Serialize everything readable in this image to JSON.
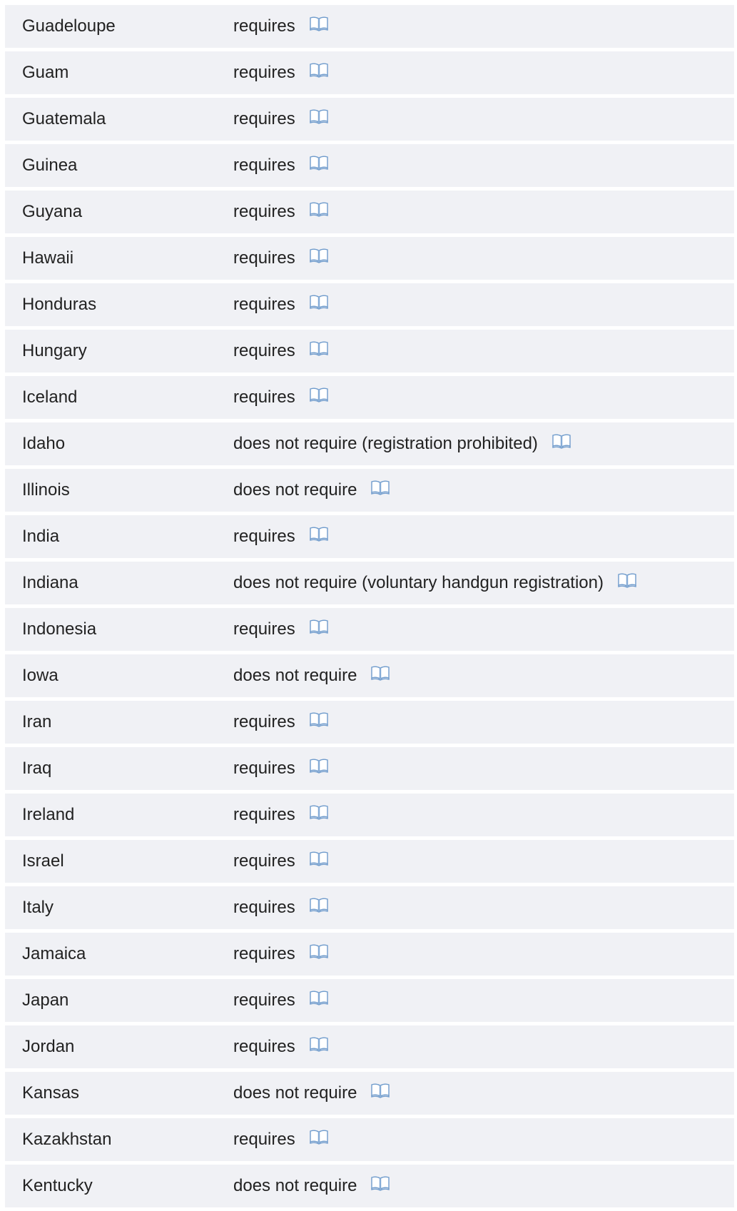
{
  "rows": [
    {
      "country": "Guadeloupe",
      "status": "requires",
      "icon": "book-icon"
    },
    {
      "country": "Guam",
      "status": "requires",
      "icon": "book-icon"
    },
    {
      "country": "Guatemala",
      "status": "requires",
      "icon": "book-icon"
    },
    {
      "country": "Guinea",
      "status": "requires",
      "icon": "book-icon"
    },
    {
      "country": "Guyana",
      "status": "requires",
      "icon": "book-icon"
    },
    {
      "country": "Hawaii",
      "status": "requires",
      "icon": "book-icon"
    },
    {
      "country": "Honduras",
      "status": "requires",
      "icon": "book-icon"
    },
    {
      "country": "Hungary",
      "status": "requires",
      "icon": "book-icon"
    },
    {
      "country": "Iceland",
      "status": "requires",
      "icon": "book-icon"
    },
    {
      "country": "Idaho",
      "status": "does not require (registration prohibited)",
      "icon": "book-icon"
    },
    {
      "country": "Illinois",
      "status": "does not require",
      "icon": "book-icon"
    },
    {
      "country": "India",
      "status": "requires",
      "icon": "book-icon"
    },
    {
      "country": "Indiana",
      "status": "does not require (voluntary handgun registration)",
      "icon": "book-icon"
    },
    {
      "country": "Indonesia",
      "status": "requires",
      "icon": "book-icon"
    },
    {
      "country": "Iowa",
      "status": "does not require",
      "icon": "book-icon"
    },
    {
      "country": "Iran",
      "status": "requires",
      "icon": "book-icon"
    },
    {
      "country": "Iraq",
      "status": "requires",
      "icon": "book-icon"
    },
    {
      "country": "Ireland",
      "status": "requires",
      "icon": "book-icon"
    },
    {
      "country": "Israel",
      "status": "requires",
      "icon": "book-icon"
    },
    {
      "country": "Italy",
      "status": "requires",
      "icon": "book-icon"
    },
    {
      "country": "Jamaica",
      "status": "requires",
      "icon": "book-icon"
    },
    {
      "country": "Japan",
      "status": "requires",
      "icon": "book-icon"
    },
    {
      "country": "Jordan",
      "status": "requires",
      "icon": "book-icon"
    },
    {
      "country": "Kansas",
      "status": "does not require",
      "icon": "book-icon"
    },
    {
      "country": "Kazakhstan",
      "status": "requires",
      "icon": "book-icon"
    },
    {
      "country": "Kentucky",
      "status": "does not require",
      "icon": "book-icon"
    }
  ],
  "colors": {
    "row_background": "#f0f1f5",
    "text": "#222222",
    "icon_blue": "#7aa7d6"
  }
}
